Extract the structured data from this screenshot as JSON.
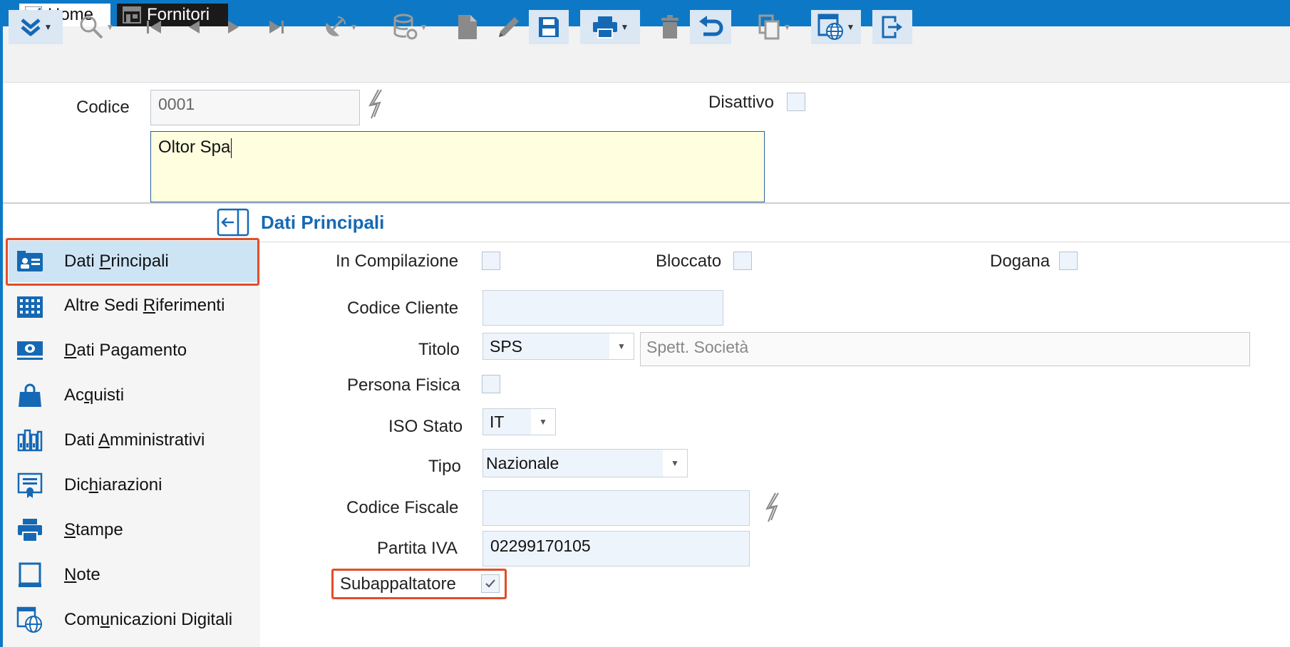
{
  "tabs": [
    {
      "label": "Home"
    },
    {
      "label": "Fornitori"
    }
  ],
  "toolbar": {
    "icons": [
      "expand-down-icon",
      "search-icon",
      "first-record-icon",
      "previous-record-icon",
      "next-record-icon",
      "last-record-icon",
      "satellite-icon",
      "database-refresh-icon",
      "new-document-icon",
      "edit-pencil-icon",
      "save-icon",
      "print-icon",
      "delete-icon",
      "undo-icon",
      "copy-icon",
      "web-icon",
      "exit-icon"
    ]
  },
  "header": {
    "codice_label": "Codice",
    "codice_value": "0001",
    "disattivo_label": "Disattivo",
    "descrizione_value": "Oltor Spa"
  },
  "section": {
    "title": "Dati Principali"
  },
  "sidebar": {
    "items": [
      {
        "pre": "Dati ",
        "ul": "P",
        "post": "rincipali",
        "icon": "id-card-icon"
      },
      {
        "pre": "Altre Sedi ",
        "ul": "R",
        "post": "iferimenti",
        "icon": "buildings-icon"
      },
      {
        "pre": "",
        "ul": "D",
        "post": "ati Pagamento",
        "icon": "money-icon"
      },
      {
        "pre": "Ac",
        "ul": "q",
        "post": "uisti",
        "icon": "shopping-bag-icon"
      },
      {
        "pre": "Dati ",
        "ul": "A",
        "post": "mministrativi",
        "icon": "binders-icon"
      },
      {
        "pre": "Dic",
        "ul": "h",
        "post": "iarazioni",
        "icon": "certificate-icon"
      },
      {
        "pre": "",
        "ul": "S",
        "post": "tampe",
        "icon": "printer-icon"
      },
      {
        "pre": "",
        "ul": "N",
        "post": "ote",
        "icon": "note-icon"
      },
      {
        "pre": "Com",
        "ul": "u",
        "post": "nicazioni Digitali",
        "icon": "digital-globe-icon"
      }
    ]
  },
  "form": {
    "in_compilazione_label": "In Compilazione",
    "bloccato_label": "Bloccato",
    "dogana_label": "Dogana",
    "codice_cliente_label": "Codice Cliente",
    "codice_cliente_value": "",
    "titolo_label": "Titolo",
    "titolo_value": "SPS",
    "titolo_desc": "Spett. Società",
    "persona_fisica_label": "Persona Fisica",
    "iso_stato_label": "ISO Stato",
    "iso_stato_value": "IT",
    "tipo_label": "Tipo",
    "tipo_value": "Nazionale",
    "codice_fiscale_label": "Codice Fiscale",
    "codice_fiscale_value": "",
    "partita_iva_label": "Partita IVA",
    "partita_iva_value": "02299170105",
    "subappaltatore_label": "Subappaltatore",
    "subappaltatore_checked": true
  },
  "colors": {
    "accent": "#0d79c6",
    "highlight": "#e34d2a",
    "active_item": "#cde4f5",
    "description_bg": "#ffffe0"
  }
}
